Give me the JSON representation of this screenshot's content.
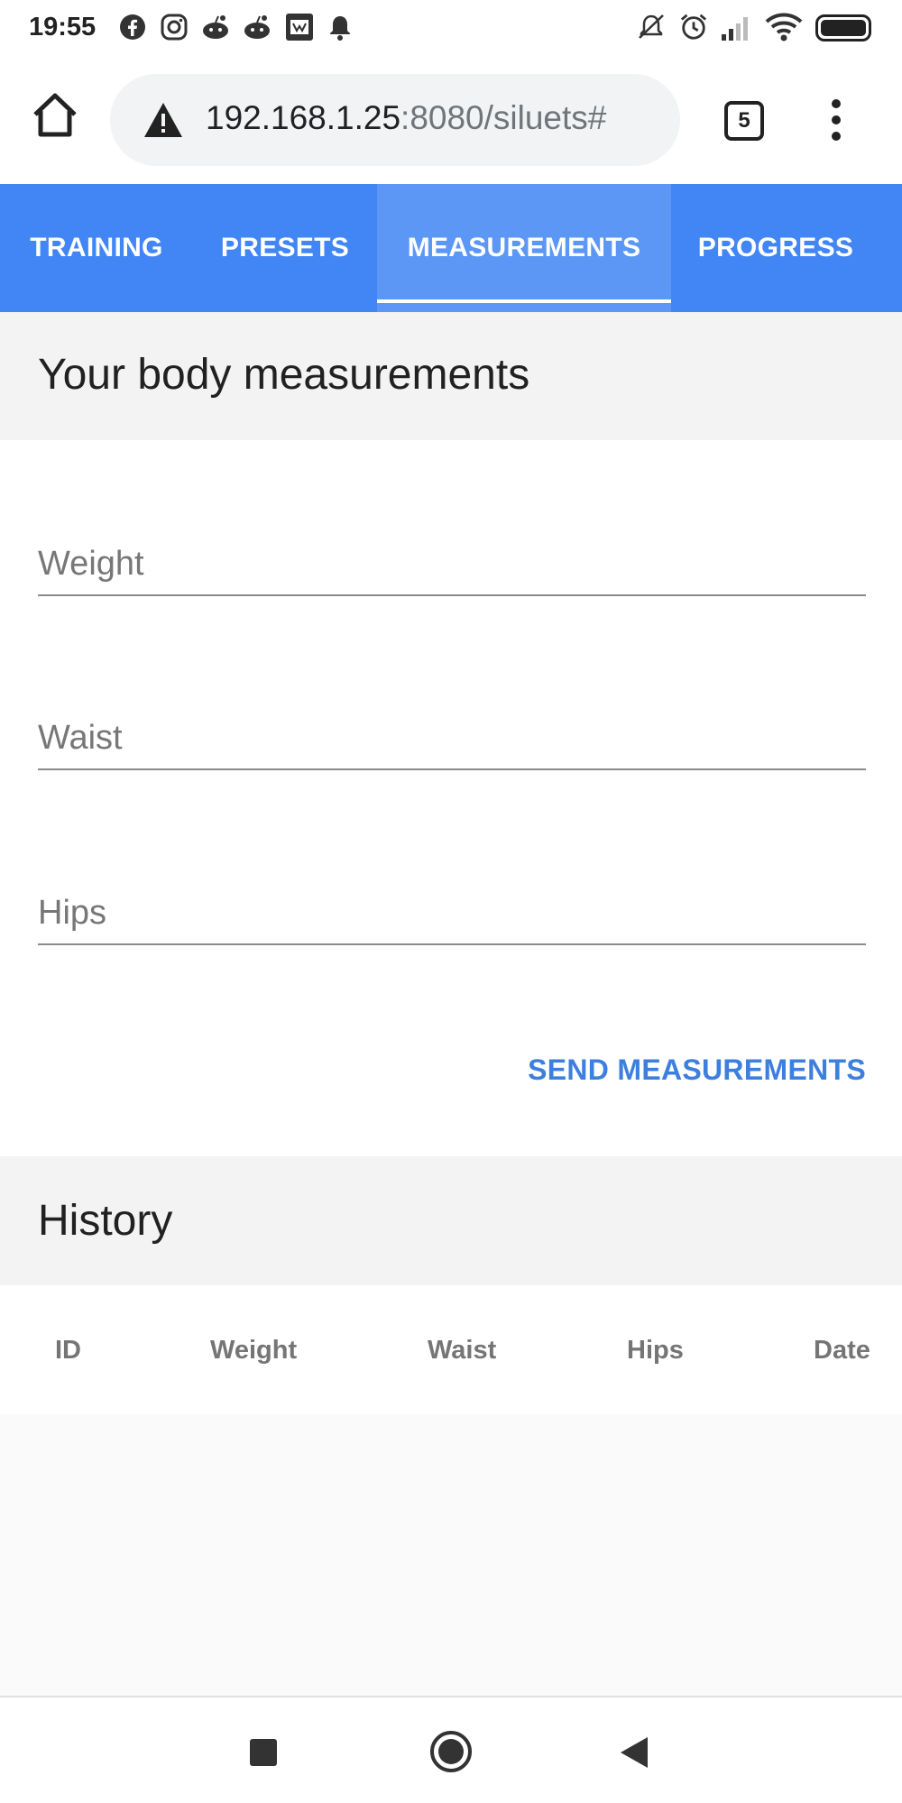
{
  "status": {
    "time": "19:55",
    "left_icons": [
      "facebook-icon",
      "instagram-icon",
      "reddit-icon",
      "reddit-icon",
      "app-icon",
      "bell-icon"
    ],
    "right_icons": [
      "mute-icon",
      "alarm-icon",
      "signal-icon",
      "wifi-icon",
      "battery-icon"
    ]
  },
  "browser": {
    "url_host": "192.168.1.25",
    "url_rest": ":8080/siluets#",
    "tab_count": "5"
  },
  "tabs": [
    {
      "label": "TRAINING"
    },
    {
      "label": "PRESETS"
    },
    {
      "label": "MEASUREMENTS",
      "active": true
    },
    {
      "label": "PROGRESS"
    }
  ],
  "measurements": {
    "title": "Your body measurements",
    "weight_placeholder": "Weight",
    "waist_placeholder": "Waist",
    "hips_placeholder": "Hips",
    "send_label": "SEND MEASUREMENTS"
  },
  "history": {
    "title": "History",
    "columns": [
      "ID",
      "Weight",
      "Waist",
      "Hips",
      "Date"
    ],
    "rows": []
  },
  "colors": {
    "accent": "#4285f4",
    "active_tab": "#5c97f6",
    "button_text": "#3d7fde"
  }
}
